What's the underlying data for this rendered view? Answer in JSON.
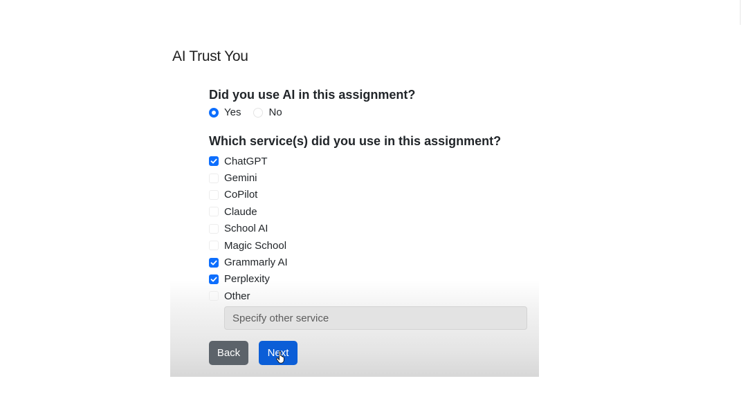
{
  "app": {
    "title": "AI Trust You"
  },
  "form": {
    "question_ai_use": "Did you use AI in this assignment?",
    "radio_options": [
      {
        "label": "Yes",
        "checked": true
      },
      {
        "label": "No",
        "checked": false
      }
    ],
    "question_services": "Which service(s) did you use in this assignment?",
    "services": [
      {
        "label": "ChatGPT",
        "checked": true
      },
      {
        "label": "Gemini",
        "checked": false
      },
      {
        "label": "CoPilot",
        "checked": false
      },
      {
        "label": "Claude",
        "checked": false
      },
      {
        "label": "School AI",
        "checked": false
      },
      {
        "label": "Magic School",
        "checked": false
      },
      {
        "label": "Grammarly AI",
        "checked": true
      },
      {
        "label": "Perplexity",
        "checked": true
      },
      {
        "label": "Other",
        "checked": false
      }
    ],
    "other_placeholder": "Specify other service",
    "other_value": ""
  },
  "buttons": {
    "back_label": "Back",
    "next_label": "Next"
  },
  "colors": {
    "accent": "#0d6efd",
    "next_button": "#0b5ed7",
    "back_button": "#5c636a"
  },
  "icons": {
    "cursor": "hand-pointer-icon",
    "check": "checkmark-icon"
  }
}
